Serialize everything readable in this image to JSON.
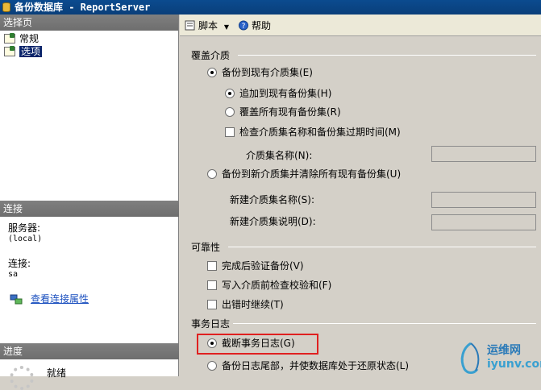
{
  "window": {
    "title": "备份数据库 - ReportServer"
  },
  "left": {
    "select_page_header": "选择页",
    "pages": [
      {
        "label": "常规"
      },
      {
        "label": "选项"
      }
    ],
    "connection_header": "连接",
    "server_label": "服务器:",
    "server_value": "(local)",
    "connection_label": "连接:",
    "connection_value": "sa",
    "view_props_link": "查看连接属性",
    "progress_header": "进度",
    "progress_status": "就绪"
  },
  "toolbar": {
    "script_label": "脚本",
    "help_label": "帮助"
  },
  "overwrite": {
    "title": "覆盖介质",
    "backup_existing": "备份到现有介质集(E)",
    "append": "追加到现有备份集(H)",
    "overwrite_all": "覆盖所有现有备份集(R)",
    "check_name_expire": "检查介质集名称和备份集过期时间(M)",
    "media_set_name_label": "介质集名称(N):",
    "backup_new": "备份到新介质集并清除所有现有备份集(U)",
    "new_media_name_label": "新建介质集名称(S):",
    "new_media_desc_label": "新建介质集说明(D):"
  },
  "reliability": {
    "title": "可靠性",
    "verify": "完成后验证备份(V)",
    "checksum": "写入介质前检查校验和(F)",
    "continue_on_error": "出错时继续(T)"
  },
  "transaction_log": {
    "title": "事务日志",
    "truncate": "截断事务日志(G)",
    "backup_tail": "备份日志尾部，并使数据库处于还原状态(L)"
  },
  "watermark": {
    "text_cn": "运维网",
    "text_en": "iyunv.com"
  }
}
